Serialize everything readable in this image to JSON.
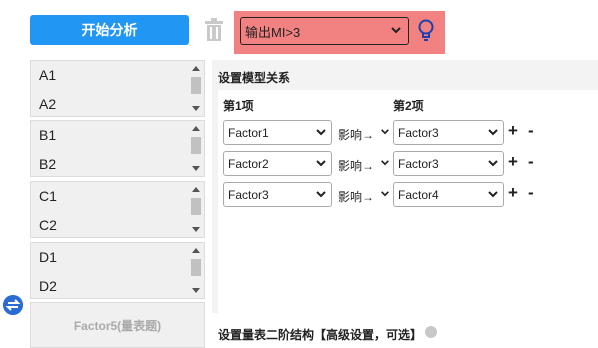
{
  "toolbar": {
    "start_label": "开始分析",
    "mi_selected": "输出MI>3",
    "mi_box_color": "#f28282",
    "start_color": "#2196f3",
    "icons": [
      "trash-icon",
      "chevron-down-icon",
      "lightbulb-icon"
    ]
  },
  "variable_lists": [
    {
      "items": [
        "A1",
        "A2"
      ]
    },
    {
      "items": [
        "B1",
        "B2"
      ]
    },
    {
      "items": [
        "C1",
        "C2"
      ]
    },
    {
      "items": [
        "D1",
        "D2"
      ]
    }
  ],
  "factor_placeholder": "Factor5(量表题)",
  "model": {
    "title": "设置模型关系",
    "col1": "第1项",
    "col2": "第2项",
    "influence_label": "影响→",
    "plus": "+",
    "minus": "-",
    "rows": [
      {
        "from": "Factor1",
        "to": "Factor3"
      },
      {
        "from": "Factor2",
        "to": "Factor3"
      },
      {
        "from": "Factor3",
        "to": "Factor4"
      }
    ]
  },
  "structure_title": "设置量表二阶结构【高级设置，可选】"
}
